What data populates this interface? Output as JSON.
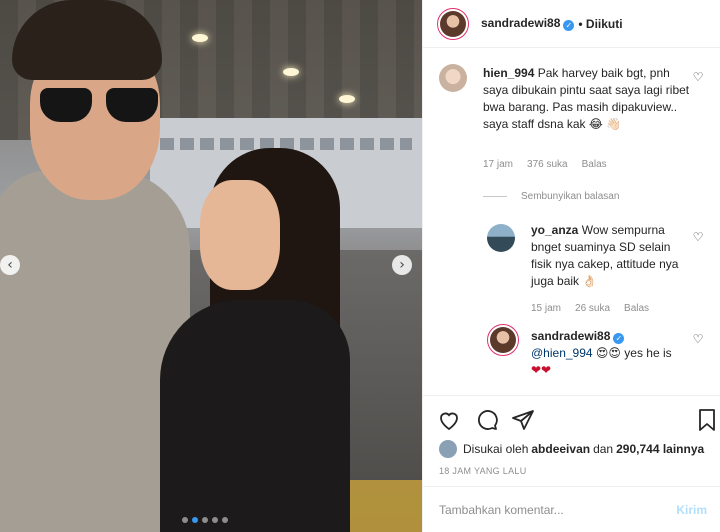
{
  "photo": {
    "carousel_dots": 5,
    "active_dot": 1
  },
  "header": {
    "username": "sandradewi88",
    "verified_icon": "verified-badge-icon",
    "follow_status": "• Diikuti"
  },
  "comments": [
    {
      "username": "hien_994",
      "text": "Pak harvey baik bgt, pnh saya dibukain pintu saat saya lagi ribet bwa barang. Pas masih dipakuview.. saya staff dsna kak 😂 👋🏻",
      "time": "17 jam",
      "likes": "376 suka",
      "reply": "Balas"
    }
  ],
  "hide_replies": "Sembunyikan balasan",
  "replies": [
    {
      "username": "yo_anza",
      "text": "Wow sempurna bnget suaminya SD selain fisik nya cakep, attitude nya juga baik 👌🏻",
      "time": "15 jam",
      "likes": "26 suka",
      "reply": "Balas"
    },
    {
      "username": "sandradewi88",
      "mention": "@hien_994",
      "text": "😍😍 yes he is",
      "hearts": "❤❤"
    }
  ],
  "likes": {
    "prefix": "Disukai oleh",
    "user": "abdeeivan",
    "mid": "dan",
    "count": "290,744 lainnya"
  },
  "timestamp": "18 JAM YANG LALU",
  "add_comment": {
    "placeholder": "Tambahkan komentar...",
    "post": "Kirim"
  }
}
